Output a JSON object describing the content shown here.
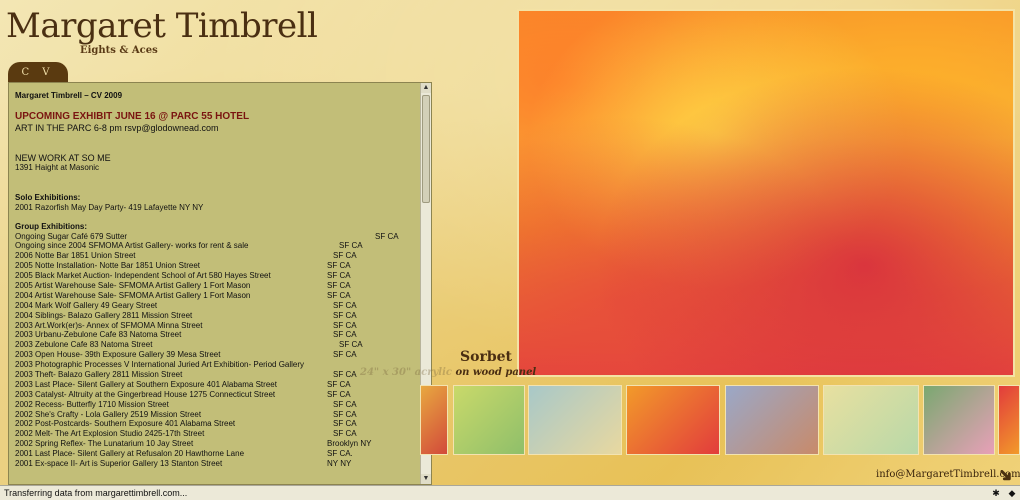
{
  "header": {
    "title": "Margaret Timbrell",
    "subtitle": "Eights & Aces",
    "tab_cv": "C V"
  },
  "cv": {
    "title": "Margaret Timbrell – CV 2009",
    "upcoming_heading": "UPCOMING EXHIBIT JUNE 16 @ PARC 55 HOTEL",
    "upcoming_detail": "ART IN THE PARC 6-8 pm rsvp@glodownead.com",
    "new_work_heading": "NEW WORK AT SO ME",
    "new_work_detail": "1391 Haight at Masonic",
    "solo_heading": "Solo Exhibitions:",
    "solo_item": "2001  Razorfish May Day Party- 419 Lafayette NY NY",
    "group_heading": "Group Exhibitions:",
    "group_items": [
      {
        "text": "Ongoing      Sugar Café 679 Sutter",
        "loc": "SF CA"
      },
      {
        "text": "Ongoing since 2004 SFMOMA Artist Gallery- works for rent & sale",
        "loc": "SF CA"
      },
      {
        "text": "2006  Notte Bar 1851 Union Street",
        "loc": "SF CA"
      },
      {
        "text": "2005  Notte Installation- Notte Bar 1851 Union Street",
        "loc": "SF CA"
      },
      {
        "text": "2005  Black Market Auction- Independent School of Art 580 Hayes Street",
        "loc": "SF CA"
      },
      {
        "text": "2005  Artist Warehouse Sale- SFMOMA Artist Gallery 1 Fort Mason",
        "loc": "SF CA"
      },
      {
        "text": "2004  Artist Warehouse Sale- SFMOMA Artist Gallery 1 Fort Mason",
        "loc": "SF CA"
      },
      {
        "text": "2004  Mark Wolf Gallery 49 Geary Street",
        "loc": "SF CA"
      },
      {
        "text": "2004  Siblings- Balazo Gallery 2811 Mission Street",
        "loc": "SF CA"
      },
      {
        "text": "2003  Art.Work(er)s- Annex of SFMOMA Minna Street",
        "loc": "SF CA"
      },
      {
        "text": "2003  Urbanu-Zebulone Cafe 83 Natoma Street",
        "loc": "SF CA"
      },
      {
        "text": "2003  Zebulone Cafe 83 Natoma Street",
        "loc": "SF CA"
      },
      {
        "text": "2003  Open House- 39th Exposure Gallery 39 Mesa Street",
        "loc": "SF CA"
      },
      {
        "text": "2003  Photographic Processes V International Juried Art Exhibition- Period Gallery",
        "loc": ""
      },
      {
        "text": "2003  Theft- Balazo Gallery 2811 Mission Street",
        "loc": "SF CA"
      },
      {
        "text": "2003  Last Place- Silent Gallery at Southern Exposure 401 Alabama Street",
        "loc": "SF CA"
      },
      {
        "text": "2003  Catalyst- Altruity at the Gingerbread House 1275 Connecticut Street",
        "loc": "SF CA"
      },
      {
        "text": "2002  Recess- Butterfly 1710 Mission Street",
        "loc": "SF CA"
      },
      {
        "text": "2002  She's Crafty - Lola Gallery 2519 Mission Street",
        "loc": "SF CA"
      },
      {
        "text": "2002  Post-Postcards- Southern Exposure 401 Alabama Street",
        "loc": "SF CA"
      },
      {
        "text": "2002  Melt- The Art Explosion Studio 2425-17th Street",
        "loc": "SF CA"
      },
      {
        "text": "2002  Spring Reflex- The Lunatarium 10 Jay Street",
        "loc": "Brooklyn NY"
      },
      {
        "text": "2001  Last Place- Silent Gallery at Refusalon 20 Hawthorne Lane",
        "loc": "SF CA."
      },
      {
        "text": "2001  Ex-space II- Art is Superior Gallery 13 Stanton Street",
        "loc": "NY NY"
      }
    ]
  },
  "featured": {
    "title": "Sorbet",
    "medium_faint": "24\" x 30\"  acrylic",
    "medium": "on wood panel"
  },
  "thumbnails": [
    {
      "color_a": "#e8a840",
      "color_b": "#d24a3a"
    },
    {
      "color_a": "#c9d96a",
      "color_b": "#8fbf6a"
    },
    {
      "color_a": "#a8c8c8",
      "color_b": "#e8d8a0"
    },
    {
      "color_a": "#f29a2a",
      "color_b": "#e23c3c"
    },
    {
      "color_a": "#9aa8c8",
      "color_b": "#c88a6a"
    },
    {
      "color_a": "#e8e0a0",
      "color_b": "#b8d8a8"
    },
    {
      "color_a": "#7aa870",
      "color_b": "#e8a0b8"
    },
    {
      "color_a": "#e23c3c",
      "color_b": "#f29a2a"
    }
  ],
  "footer": {
    "email": "info@MargaretTimbrell.com"
  },
  "statusbar": {
    "text": "Transferring data from margarettimbrell.com..."
  },
  "colors": {
    "panel": "#c2be78",
    "accent": "#7a1410",
    "brand": "#4a2f12"
  }
}
